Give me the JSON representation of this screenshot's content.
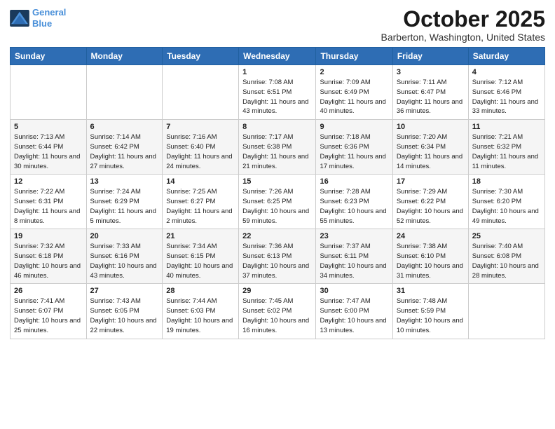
{
  "header": {
    "logo_line1": "General",
    "logo_line2": "Blue",
    "month": "October 2025",
    "location": "Barberton, Washington, United States"
  },
  "weekdays": [
    "Sunday",
    "Monday",
    "Tuesday",
    "Wednesday",
    "Thursday",
    "Friday",
    "Saturday"
  ],
  "weeks": [
    [
      {
        "day": "",
        "sunrise": "",
        "sunset": "",
        "daylight": ""
      },
      {
        "day": "",
        "sunrise": "",
        "sunset": "",
        "daylight": ""
      },
      {
        "day": "",
        "sunrise": "",
        "sunset": "",
        "daylight": ""
      },
      {
        "day": "1",
        "sunrise": "Sunrise: 7:08 AM",
        "sunset": "Sunset: 6:51 PM",
        "daylight": "Daylight: 11 hours and 43 minutes."
      },
      {
        "day": "2",
        "sunrise": "Sunrise: 7:09 AM",
        "sunset": "Sunset: 6:49 PM",
        "daylight": "Daylight: 11 hours and 40 minutes."
      },
      {
        "day": "3",
        "sunrise": "Sunrise: 7:11 AM",
        "sunset": "Sunset: 6:47 PM",
        "daylight": "Daylight: 11 hours and 36 minutes."
      },
      {
        "day": "4",
        "sunrise": "Sunrise: 7:12 AM",
        "sunset": "Sunset: 6:46 PM",
        "daylight": "Daylight: 11 hours and 33 minutes."
      }
    ],
    [
      {
        "day": "5",
        "sunrise": "Sunrise: 7:13 AM",
        "sunset": "Sunset: 6:44 PM",
        "daylight": "Daylight: 11 hours and 30 minutes."
      },
      {
        "day": "6",
        "sunrise": "Sunrise: 7:14 AM",
        "sunset": "Sunset: 6:42 PM",
        "daylight": "Daylight: 11 hours and 27 minutes."
      },
      {
        "day": "7",
        "sunrise": "Sunrise: 7:16 AM",
        "sunset": "Sunset: 6:40 PM",
        "daylight": "Daylight: 11 hours and 24 minutes."
      },
      {
        "day": "8",
        "sunrise": "Sunrise: 7:17 AM",
        "sunset": "Sunset: 6:38 PM",
        "daylight": "Daylight: 11 hours and 21 minutes."
      },
      {
        "day": "9",
        "sunrise": "Sunrise: 7:18 AM",
        "sunset": "Sunset: 6:36 PM",
        "daylight": "Daylight: 11 hours and 17 minutes."
      },
      {
        "day": "10",
        "sunrise": "Sunrise: 7:20 AM",
        "sunset": "Sunset: 6:34 PM",
        "daylight": "Daylight: 11 hours and 14 minutes."
      },
      {
        "day": "11",
        "sunrise": "Sunrise: 7:21 AM",
        "sunset": "Sunset: 6:32 PM",
        "daylight": "Daylight: 11 hours and 11 minutes."
      }
    ],
    [
      {
        "day": "12",
        "sunrise": "Sunrise: 7:22 AM",
        "sunset": "Sunset: 6:31 PM",
        "daylight": "Daylight: 11 hours and 8 minutes."
      },
      {
        "day": "13",
        "sunrise": "Sunrise: 7:24 AM",
        "sunset": "Sunset: 6:29 PM",
        "daylight": "Daylight: 11 hours and 5 minutes."
      },
      {
        "day": "14",
        "sunrise": "Sunrise: 7:25 AM",
        "sunset": "Sunset: 6:27 PM",
        "daylight": "Daylight: 11 hours and 2 minutes."
      },
      {
        "day": "15",
        "sunrise": "Sunrise: 7:26 AM",
        "sunset": "Sunset: 6:25 PM",
        "daylight": "Daylight: 10 hours and 59 minutes."
      },
      {
        "day": "16",
        "sunrise": "Sunrise: 7:28 AM",
        "sunset": "Sunset: 6:23 PM",
        "daylight": "Daylight: 10 hours and 55 minutes."
      },
      {
        "day": "17",
        "sunrise": "Sunrise: 7:29 AM",
        "sunset": "Sunset: 6:22 PM",
        "daylight": "Daylight: 10 hours and 52 minutes."
      },
      {
        "day": "18",
        "sunrise": "Sunrise: 7:30 AM",
        "sunset": "Sunset: 6:20 PM",
        "daylight": "Daylight: 10 hours and 49 minutes."
      }
    ],
    [
      {
        "day": "19",
        "sunrise": "Sunrise: 7:32 AM",
        "sunset": "Sunset: 6:18 PM",
        "daylight": "Daylight: 10 hours and 46 minutes."
      },
      {
        "day": "20",
        "sunrise": "Sunrise: 7:33 AM",
        "sunset": "Sunset: 6:16 PM",
        "daylight": "Daylight: 10 hours and 43 minutes."
      },
      {
        "day": "21",
        "sunrise": "Sunrise: 7:34 AM",
        "sunset": "Sunset: 6:15 PM",
        "daylight": "Daylight: 10 hours and 40 minutes."
      },
      {
        "day": "22",
        "sunrise": "Sunrise: 7:36 AM",
        "sunset": "Sunset: 6:13 PM",
        "daylight": "Daylight: 10 hours and 37 minutes."
      },
      {
        "day": "23",
        "sunrise": "Sunrise: 7:37 AM",
        "sunset": "Sunset: 6:11 PM",
        "daylight": "Daylight: 10 hours and 34 minutes."
      },
      {
        "day": "24",
        "sunrise": "Sunrise: 7:38 AM",
        "sunset": "Sunset: 6:10 PM",
        "daylight": "Daylight: 10 hours and 31 minutes."
      },
      {
        "day": "25",
        "sunrise": "Sunrise: 7:40 AM",
        "sunset": "Sunset: 6:08 PM",
        "daylight": "Daylight: 10 hours and 28 minutes."
      }
    ],
    [
      {
        "day": "26",
        "sunrise": "Sunrise: 7:41 AM",
        "sunset": "Sunset: 6:07 PM",
        "daylight": "Daylight: 10 hours and 25 minutes."
      },
      {
        "day": "27",
        "sunrise": "Sunrise: 7:43 AM",
        "sunset": "Sunset: 6:05 PM",
        "daylight": "Daylight: 10 hours and 22 minutes."
      },
      {
        "day": "28",
        "sunrise": "Sunrise: 7:44 AM",
        "sunset": "Sunset: 6:03 PM",
        "daylight": "Daylight: 10 hours and 19 minutes."
      },
      {
        "day": "29",
        "sunrise": "Sunrise: 7:45 AM",
        "sunset": "Sunset: 6:02 PM",
        "daylight": "Daylight: 10 hours and 16 minutes."
      },
      {
        "day": "30",
        "sunrise": "Sunrise: 7:47 AM",
        "sunset": "Sunset: 6:00 PM",
        "daylight": "Daylight: 10 hours and 13 minutes."
      },
      {
        "day": "31",
        "sunrise": "Sunrise: 7:48 AM",
        "sunset": "Sunset: 5:59 PM",
        "daylight": "Daylight: 10 hours and 10 minutes."
      },
      {
        "day": "",
        "sunrise": "",
        "sunset": "",
        "daylight": ""
      }
    ]
  ]
}
